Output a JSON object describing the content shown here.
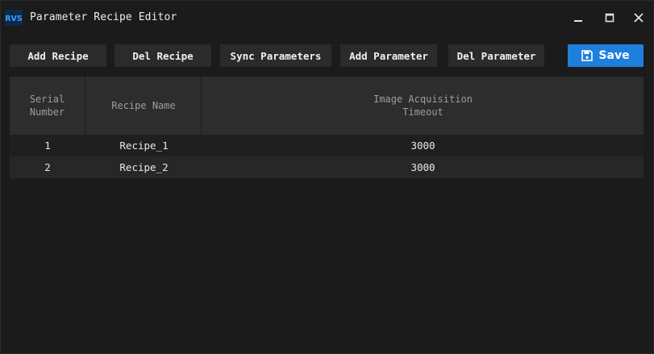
{
  "window": {
    "title": "Parameter Recipe Editor",
    "logo_text": "RVS",
    "logo_icon": "rvs-logo-icon",
    "controls": [
      "minimize-icon",
      "maximize-icon",
      "close-icon"
    ]
  },
  "toolbar": {
    "add_recipe": "Add Recipe",
    "del_recipe": "Del Recipe",
    "sync_parameters": "Sync Parameters",
    "add_parameter": "Add Parameter",
    "del_parameter": "Del Parameter",
    "save": "Save",
    "save_icon": "floppy-disk-icon"
  },
  "table": {
    "headers": {
      "serial": "Serial Number",
      "name": "Recipe Name",
      "timeout_line1": "Image Acquisition",
      "timeout_line2": "Timeout"
    },
    "rows": [
      {
        "serial": "1",
        "name": "Recipe_1",
        "timeout": "3000"
      },
      {
        "serial": "2",
        "name": "Recipe_2",
        "timeout": "3000"
      }
    ]
  },
  "colors": {
    "background": "#1b1b1b",
    "button": "#2b2b2b",
    "accent": "#1e7fdc",
    "header": "#2d2d2d"
  }
}
